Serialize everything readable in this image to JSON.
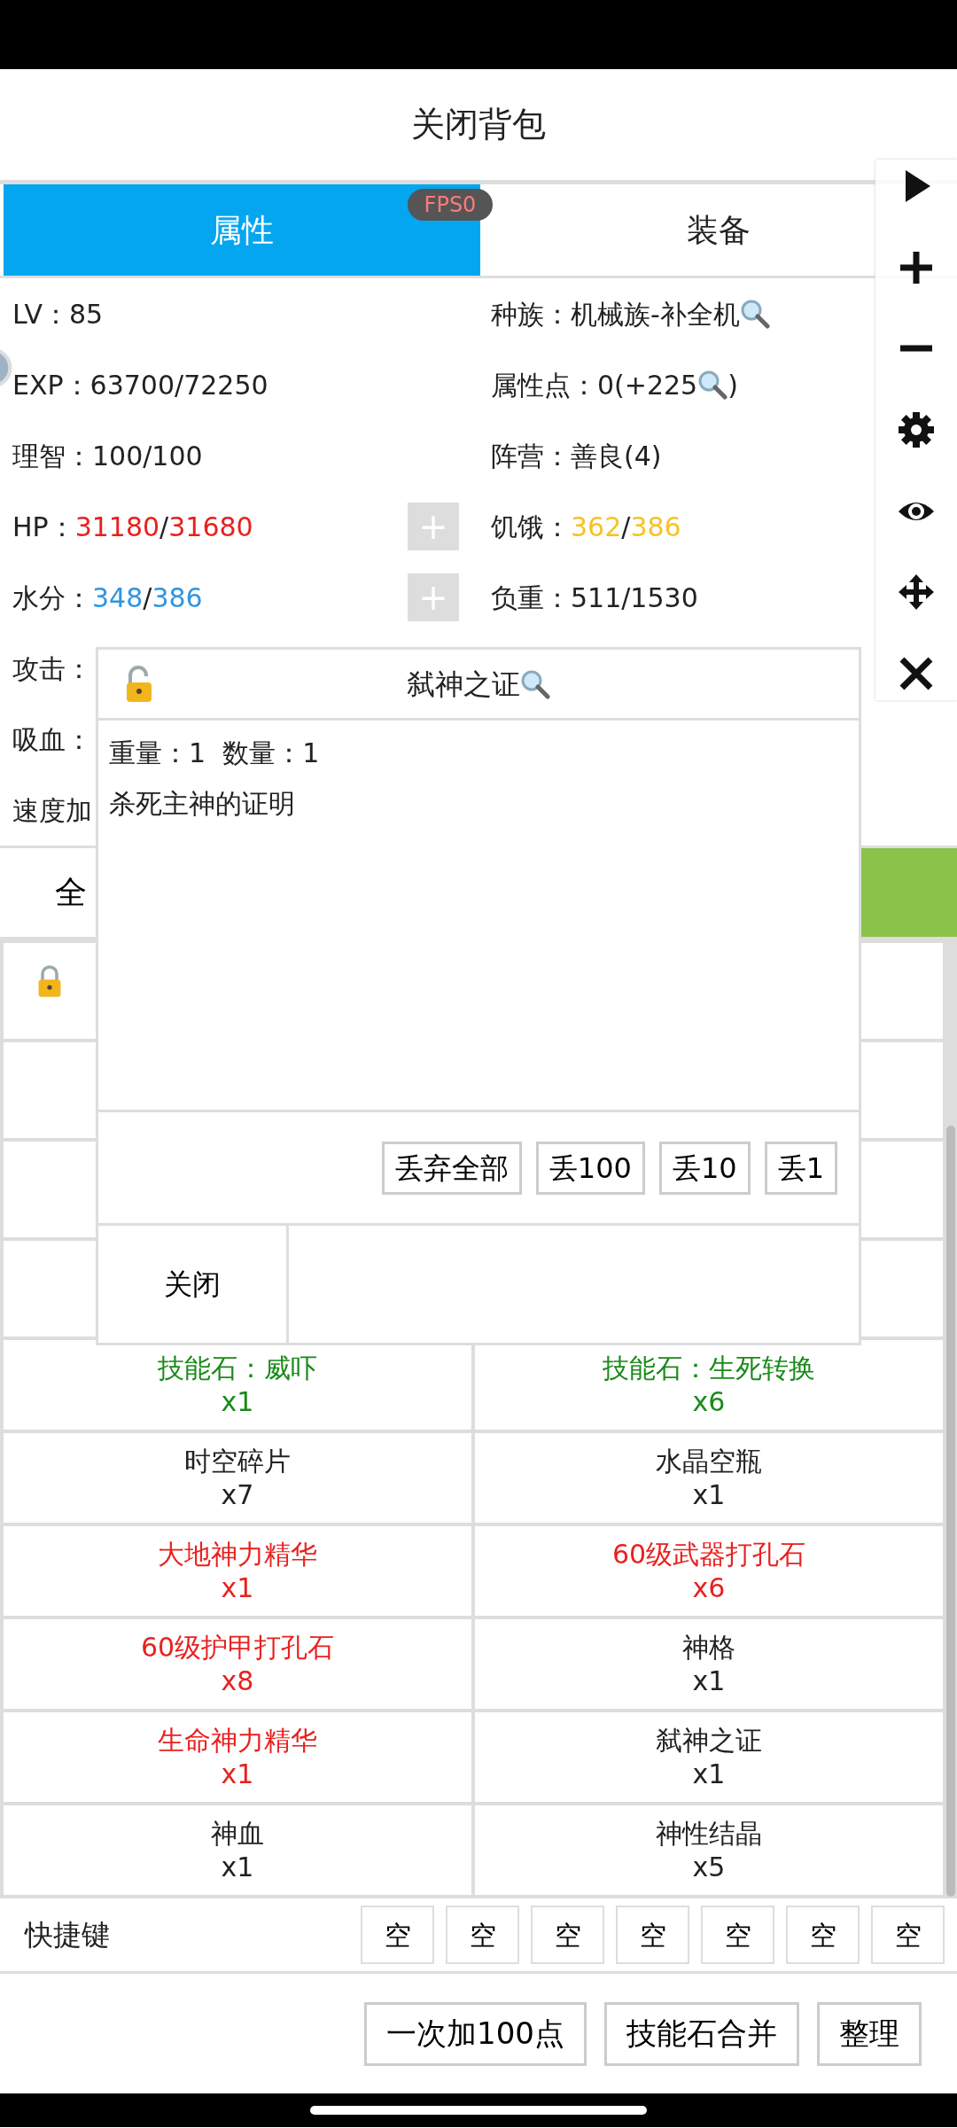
{
  "title": "关闭背包",
  "tabs": [
    {
      "label": "属性",
      "selected": true
    },
    {
      "label": "装备",
      "selected": false
    }
  ],
  "fps_badge": "FPS0",
  "toolbar": [
    {
      "kind": "play"
    },
    {
      "kind": "plus"
    },
    {
      "kind": "minus"
    },
    {
      "kind": "settings"
    },
    {
      "kind": "eye"
    },
    {
      "kind": "move"
    },
    {
      "kind": "close"
    }
  ],
  "stats": [
    {
      "left": {
        "label": "LV：",
        "parts": [
          {
            "kind": "text",
            "text": "85"
          }
        ]
      },
      "right": {
        "label": "种族：",
        "parts": [
          {
            "kind": "text",
            "text": "机械族-补全机"
          },
          {
            "kind": "magnifier"
          }
        ]
      }
    },
    {
      "left": {
        "label": "EXP：",
        "parts": [
          {
            "kind": "text",
            "text": "63700/72250"
          }
        ]
      },
      "right": {
        "label": "属性点：",
        "parts": [
          {
            "kind": "text",
            "text": "0(+225"
          },
          {
            "kind": "magnifier"
          },
          {
            "kind": "text",
            "text": ")"
          }
        ]
      }
    },
    {
      "left": {
        "label": "理智：",
        "parts": [
          {
            "kind": "text",
            "text": "100/100"
          }
        ]
      },
      "right": {
        "label": "阵营：",
        "parts": [
          {
            "kind": "text",
            "text": "善良(4)"
          }
        ]
      }
    },
    {
      "left": {
        "label": "HP：",
        "parts": [
          {
            "kind": "text",
            "text": "31180",
            "color": "#e8211f"
          },
          {
            "kind": "text",
            "text": "/"
          },
          {
            "kind": "text",
            "text": "31680",
            "color": "#e8211f"
          }
        ],
        "plus_button": "+"
      },
      "right": {
        "label": "饥饿：",
        "parts": [
          {
            "kind": "text",
            "text": "362",
            "color": "#f5c326"
          },
          {
            "kind": "text",
            "text": "/"
          },
          {
            "kind": "text",
            "text": "386",
            "color": "#f5c326"
          }
        ]
      }
    },
    {
      "left": {
        "label": "水分：",
        "parts": [
          {
            "kind": "text",
            "text": "348",
            "color": "#2f96e0"
          },
          {
            "kind": "text",
            "text": "/"
          },
          {
            "kind": "text",
            "text": "386",
            "color": "#2f96e0"
          }
        ],
        "plus_button": "+"
      },
      "right": {
        "label": "负重：",
        "parts": [
          {
            "kind": "text",
            "text": "511/1530"
          }
        ]
      }
    },
    {
      "left": {
        "label": "攻击："
      }
    },
    {
      "left": {
        "label": "吸血："
      }
    },
    {
      "left": {
        "label": "速度加"
      }
    }
  ],
  "bag_tabs": [
    {
      "label": "全",
      "selected": false
    },
    {
      "selected": true
    }
  ],
  "covered_rows": [
    {
      "locked": true
    },
    {
      "locked": false
    },
    {
      "locked": false
    },
    {
      "locked": false
    }
  ],
  "items": [
    {
      "name": "技能石：威吓",
      "count": "x1",
      "color": "#1a8a1a"
    },
    {
      "name": "技能石：生死转换",
      "count": "x6",
      "color": "#1a8a1a"
    },
    {
      "name": "时空碎片",
      "count": "x7",
      "color": "#222222"
    },
    {
      "name": "水晶空瓶",
      "count": "x1",
      "color": "#222222"
    },
    {
      "name": "大地神力精华",
      "count": "x1",
      "color": "#e8211f"
    },
    {
      "name": "60级武器打孔石",
      "count": "x6",
      "color": "#e8211f"
    },
    {
      "name": "60级护甲打孔石",
      "count": "x8",
      "color": "#e8211f"
    },
    {
      "name": "神格",
      "count": "x1",
      "color": "#222222"
    },
    {
      "name": "生命神力精华",
      "count": "x1",
      "color": "#e8211f"
    },
    {
      "name": "弑神之证",
      "count": "x1",
      "color": "#222222"
    },
    {
      "name": "神血",
      "count": "x1",
      "color": "#222222"
    },
    {
      "name": "神性结晶",
      "count": "x5",
      "color": "#222222"
    }
  ],
  "quick_keys": {
    "label": "快捷键",
    "slots": [
      "空",
      "空",
      "空",
      "空",
      "空",
      "空",
      "空"
    ]
  },
  "actions": [
    "一次加100点",
    "技能石合并",
    "整理"
  ],
  "dialog": {
    "locked": false,
    "title": "弑神之证",
    "title_lookup": true,
    "lines": [
      "重量：1  数量：1",
      "杀死主神的证明"
    ],
    "drop_buttons": [
      "丢弃全部",
      "丢100",
      "丢10",
      "丢1"
    ],
    "close_button": "关闭"
  }
}
